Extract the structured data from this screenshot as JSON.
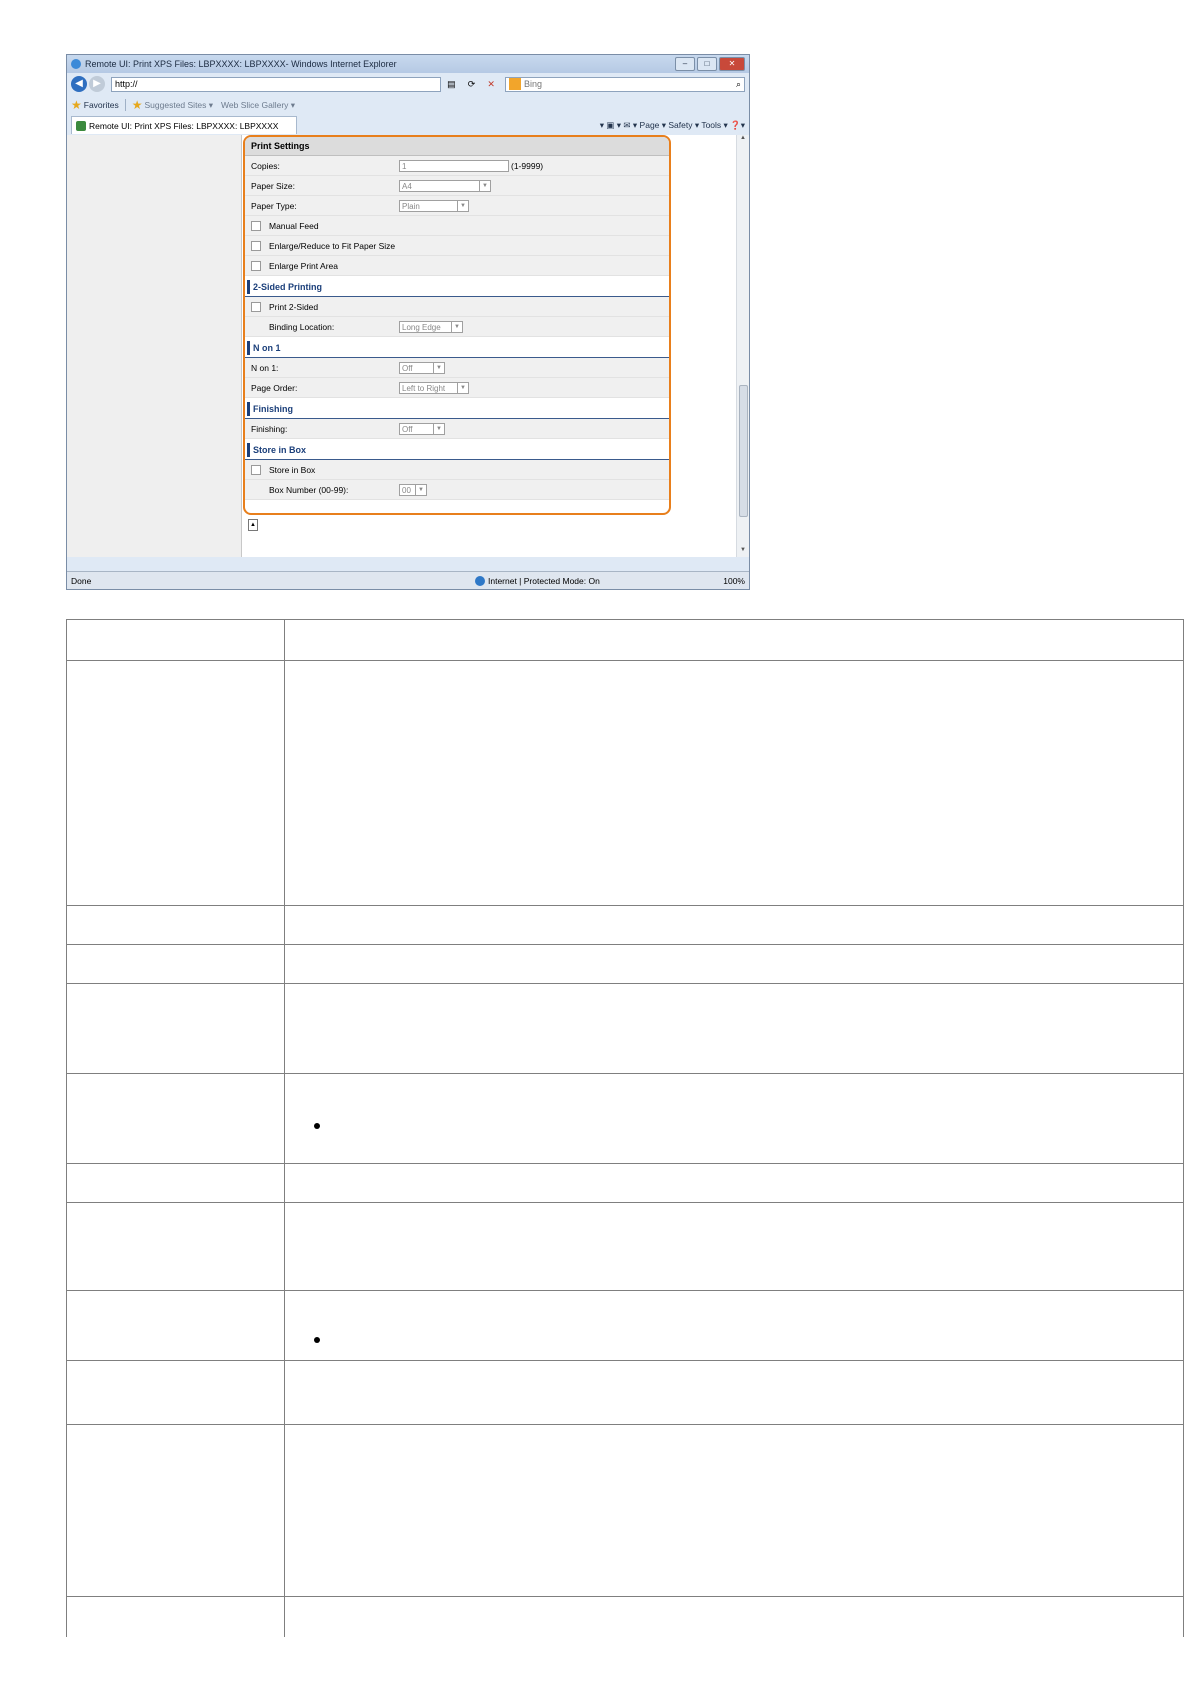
{
  "browser": {
    "window_title": "Remote UI: Print XPS Files: LBPXXXX: LBPXXXX- Windows Internet Explorer",
    "address": "http://",
    "search_placeholder": "Bing",
    "favorites_label": "Favorites",
    "suggested_sites": "Suggested Sites ▾",
    "web_slice_gallery": "Web Slice Gallery ▾",
    "tab_title": "Remote UI: Print XPS Files: LBPXXXX: LBPXXXX",
    "command_bar": "▾ ▣ ▾ ✉ ▾ Page ▾  Safety ▾  Tools ▾  ❓▾",
    "status_done": "Done",
    "status_zone": "Internet | Protected Mode: On",
    "status_zoom": "100%"
  },
  "form": {
    "print_settings_title": "Print Settings",
    "copies_label": "Copies:",
    "copies_value": "1",
    "copies_range": "(1-9999)",
    "paper_size_label": "Paper Size:",
    "paper_size_value": "A4",
    "paper_type_label": "Paper Type:",
    "paper_type_value": "Plain",
    "manual_feed_label": "Manual Feed",
    "enlarge_reduce_label": "Enlarge/Reduce to Fit Paper Size",
    "enlarge_print_area_label": "Enlarge Print Area",
    "two_sided_title": "2-Sided Printing",
    "print_2sided_label": "Print 2-Sided",
    "binding_location_label": "Binding Location:",
    "binding_location_value": "Long Edge",
    "n_on_1_title": "N on 1",
    "n_on_1_label": "N on 1:",
    "n_on_1_value": "Off",
    "page_order_label": "Page Order:",
    "page_order_value": "Left to Right",
    "finishing_title": "Finishing",
    "finishing_label": "Finishing:",
    "finishing_value": "Off",
    "store_in_box_title": "Store in Box",
    "store_in_box_label": "Store in Box",
    "box_number_label": "Box Number (00-99):",
    "box_number_value": "00"
  },
  "colors": {
    "highlight_border": "#e87f1c",
    "section_accent": "#1b3f7a"
  }
}
